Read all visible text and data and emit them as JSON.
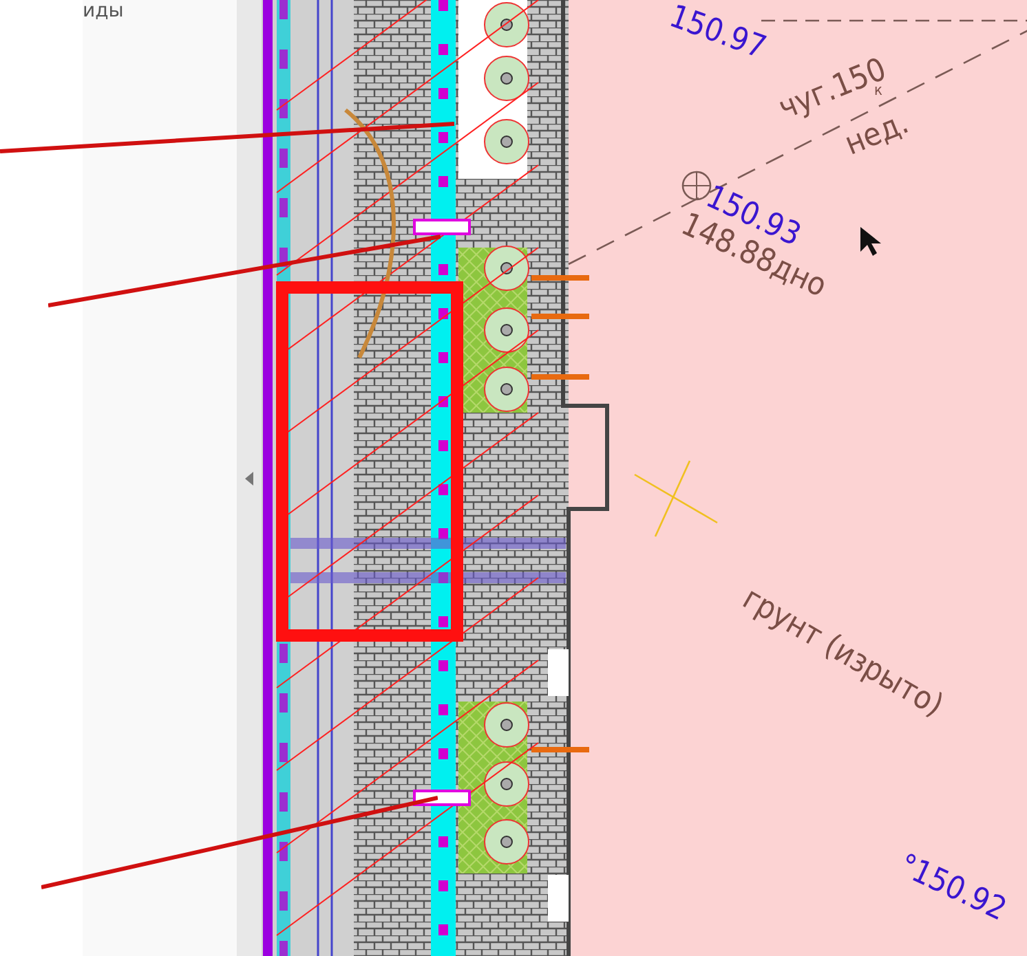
{
  "side_panel": {
    "heading": "иды"
  },
  "canvas": {
    "labels": [
      {
        "text": "150.97",
        "kind": "elevation"
      },
      {
        "text": "чуг.150",
        "kind": "note"
      },
      {
        "text": "к",
        "kind": "mark"
      },
      {
        "text": "нед.",
        "kind": "note"
      },
      {
        "text": "150.93",
        "kind": "elevation"
      },
      {
        "text": "148.88дно",
        "kind": "note"
      },
      {
        "text": "грунт (изрыто)",
        "kind": "note"
      },
      {
        "text": "°150.92",
        "kind": "elevation"
      }
    ]
  }
}
